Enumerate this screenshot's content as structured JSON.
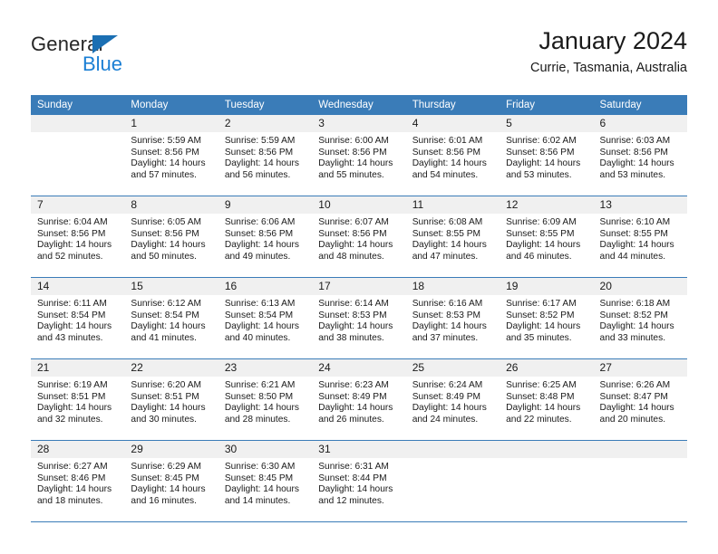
{
  "logo": {
    "word_one": "General",
    "word_two": "Blue",
    "triangle_color": "#1b6fb3",
    "blue_color": "#1b7fd4"
  },
  "header": {
    "title": "January 2024",
    "location": "Currie, Tasmania, Australia",
    "header_bg": "#3a7cb8",
    "daynum_bg": "#f0f0f0"
  },
  "weekday_headers": [
    "Sunday",
    "Monday",
    "Tuesday",
    "Wednesday",
    "Thursday",
    "Friday",
    "Saturday"
  ],
  "labels": {
    "sunrise": "Sunrise:",
    "sunset": "Sunset:",
    "daylight": "Daylight:"
  },
  "weeks": [
    [
      {
        "day": "",
        "sunrise": "",
        "sunset": "",
        "daylight_line1": "",
        "daylight_line2": ""
      },
      {
        "day": "1",
        "sunrise": "Sunrise: 5:59 AM",
        "sunset": "Sunset: 8:56 PM",
        "daylight_line1": "Daylight: 14 hours",
        "daylight_line2": "and 57 minutes."
      },
      {
        "day": "2",
        "sunrise": "Sunrise: 5:59 AM",
        "sunset": "Sunset: 8:56 PM",
        "daylight_line1": "Daylight: 14 hours",
        "daylight_line2": "and 56 minutes."
      },
      {
        "day": "3",
        "sunrise": "Sunrise: 6:00 AM",
        "sunset": "Sunset: 8:56 PM",
        "daylight_line1": "Daylight: 14 hours",
        "daylight_line2": "and 55 minutes."
      },
      {
        "day": "4",
        "sunrise": "Sunrise: 6:01 AM",
        "sunset": "Sunset: 8:56 PM",
        "daylight_line1": "Daylight: 14 hours",
        "daylight_line2": "and 54 minutes."
      },
      {
        "day": "5",
        "sunrise": "Sunrise: 6:02 AM",
        "sunset": "Sunset: 8:56 PM",
        "daylight_line1": "Daylight: 14 hours",
        "daylight_line2": "and 53 minutes."
      },
      {
        "day": "6",
        "sunrise": "Sunrise: 6:03 AM",
        "sunset": "Sunset: 8:56 PM",
        "daylight_line1": "Daylight: 14 hours",
        "daylight_line2": "and 53 minutes."
      }
    ],
    [
      {
        "day": "7",
        "sunrise": "Sunrise: 6:04 AM",
        "sunset": "Sunset: 8:56 PM",
        "daylight_line1": "Daylight: 14 hours",
        "daylight_line2": "and 52 minutes."
      },
      {
        "day": "8",
        "sunrise": "Sunrise: 6:05 AM",
        "sunset": "Sunset: 8:56 PM",
        "daylight_line1": "Daylight: 14 hours",
        "daylight_line2": "and 50 minutes."
      },
      {
        "day": "9",
        "sunrise": "Sunrise: 6:06 AM",
        "sunset": "Sunset: 8:56 PM",
        "daylight_line1": "Daylight: 14 hours",
        "daylight_line2": "and 49 minutes."
      },
      {
        "day": "10",
        "sunrise": "Sunrise: 6:07 AM",
        "sunset": "Sunset: 8:56 PM",
        "daylight_line1": "Daylight: 14 hours",
        "daylight_line2": "and 48 minutes."
      },
      {
        "day": "11",
        "sunrise": "Sunrise: 6:08 AM",
        "sunset": "Sunset: 8:55 PM",
        "daylight_line1": "Daylight: 14 hours",
        "daylight_line2": "and 47 minutes."
      },
      {
        "day": "12",
        "sunrise": "Sunrise: 6:09 AM",
        "sunset": "Sunset: 8:55 PM",
        "daylight_line1": "Daylight: 14 hours",
        "daylight_line2": "and 46 minutes."
      },
      {
        "day": "13",
        "sunrise": "Sunrise: 6:10 AM",
        "sunset": "Sunset: 8:55 PM",
        "daylight_line1": "Daylight: 14 hours",
        "daylight_line2": "and 44 minutes."
      }
    ],
    [
      {
        "day": "14",
        "sunrise": "Sunrise: 6:11 AM",
        "sunset": "Sunset: 8:54 PM",
        "daylight_line1": "Daylight: 14 hours",
        "daylight_line2": "and 43 minutes."
      },
      {
        "day": "15",
        "sunrise": "Sunrise: 6:12 AM",
        "sunset": "Sunset: 8:54 PM",
        "daylight_line1": "Daylight: 14 hours",
        "daylight_line2": "and 41 minutes."
      },
      {
        "day": "16",
        "sunrise": "Sunrise: 6:13 AM",
        "sunset": "Sunset: 8:54 PM",
        "daylight_line1": "Daylight: 14 hours",
        "daylight_line2": "and 40 minutes."
      },
      {
        "day": "17",
        "sunrise": "Sunrise: 6:14 AM",
        "sunset": "Sunset: 8:53 PM",
        "daylight_line1": "Daylight: 14 hours",
        "daylight_line2": "and 38 minutes."
      },
      {
        "day": "18",
        "sunrise": "Sunrise: 6:16 AM",
        "sunset": "Sunset: 8:53 PM",
        "daylight_line1": "Daylight: 14 hours",
        "daylight_line2": "and 37 minutes."
      },
      {
        "day": "19",
        "sunrise": "Sunrise: 6:17 AM",
        "sunset": "Sunset: 8:52 PM",
        "daylight_line1": "Daylight: 14 hours",
        "daylight_line2": "and 35 minutes."
      },
      {
        "day": "20",
        "sunrise": "Sunrise: 6:18 AM",
        "sunset": "Sunset: 8:52 PM",
        "daylight_line1": "Daylight: 14 hours",
        "daylight_line2": "and 33 minutes."
      }
    ],
    [
      {
        "day": "21",
        "sunrise": "Sunrise: 6:19 AM",
        "sunset": "Sunset: 8:51 PM",
        "daylight_line1": "Daylight: 14 hours",
        "daylight_line2": "and 32 minutes."
      },
      {
        "day": "22",
        "sunrise": "Sunrise: 6:20 AM",
        "sunset": "Sunset: 8:51 PM",
        "daylight_line1": "Daylight: 14 hours",
        "daylight_line2": "and 30 minutes."
      },
      {
        "day": "23",
        "sunrise": "Sunrise: 6:21 AM",
        "sunset": "Sunset: 8:50 PM",
        "daylight_line1": "Daylight: 14 hours",
        "daylight_line2": "and 28 minutes."
      },
      {
        "day": "24",
        "sunrise": "Sunrise: 6:23 AM",
        "sunset": "Sunset: 8:49 PM",
        "daylight_line1": "Daylight: 14 hours",
        "daylight_line2": "and 26 minutes."
      },
      {
        "day": "25",
        "sunrise": "Sunrise: 6:24 AM",
        "sunset": "Sunset: 8:49 PM",
        "daylight_line1": "Daylight: 14 hours",
        "daylight_line2": "and 24 minutes."
      },
      {
        "day": "26",
        "sunrise": "Sunrise: 6:25 AM",
        "sunset": "Sunset: 8:48 PM",
        "daylight_line1": "Daylight: 14 hours",
        "daylight_line2": "and 22 minutes."
      },
      {
        "day": "27",
        "sunrise": "Sunrise: 6:26 AM",
        "sunset": "Sunset: 8:47 PM",
        "daylight_line1": "Daylight: 14 hours",
        "daylight_line2": "and 20 minutes."
      }
    ],
    [
      {
        "day": "28",
        "sunrise": "Sunrise: 6:27 AM",
        "sunset": "Sunset: 8:46 PM",
        "daylight_line1": "Daylight: 14 hours",
        "daylight_line2": "and 18 minutes."
      },
      {
        "day": "29",
        "sunrise": "Sunrise: 6:29 AM",
        "sunset": "Sunset: 8:45 PM",
        "daylight_line1": "Daylight: 14 hours",
        "daylight_line2": "and 16 minutes."
      },
      {
        "day": "30",
        "sunrise": "Sunrise: 6:30 AM",
        "sunset": "Sunset: 8:45 PM",
        "daylight_line1": "Daylight: 14 hours",
        "daylight_line2": "and 14 minutes."
      },
      {
        "day": "31",
        "sunrise": "Sunrise: 6:31 AM",
        "sunset": "Sunset: 8:44 PM",
        "daylight_line1": "Daylight: 14 hours",
        "daylight_line2": "and 12 minutes."
      },
      {
        "day": "",
        "sunrise": "",
        "sunset": "",
        "daylight_line1": "",
        "daylight_line2": ""
      },
      {
        "day": "",
        "sunrise": "",
        "sunset": "",
        "daylight_line1": "",
        "daylight_line2": ""
      },
      {
        "day": "",
        "sunrise": "",
        "sunset": "",
        "daylight_line1": "",
        "daylight_line2": ""
      }
    ]
  ]
}
